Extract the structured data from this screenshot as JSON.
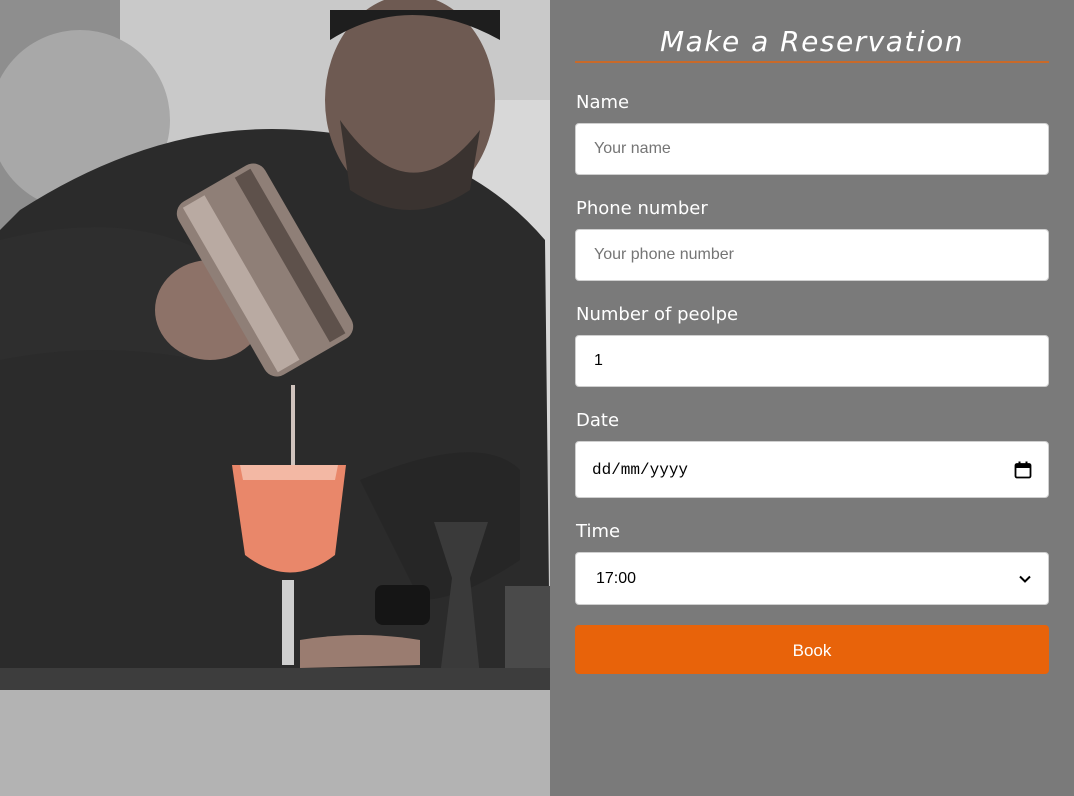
{
  "form": {
    "title": "Make a Reservation",
    "fields": {
      "name": {
        "label": "Name",
        "placeholder": "Your name",
        "value": ""
      },
      "phone": {
        "label": "Phone number",
        "placeholder": "Your phone number",
        "value": ""
      },
      "people": {
        "label": "Number of peolpe",
        "value": "1"
      },
      "date": {
        "label": "Date",
        "value": "dd/mm/yyyy"
      },
      "time": {
        "label": "Time",
        "value": "17:00"
      }
    },
    "submit_label": "Book"
  },
  "colors": {
    "panel_bg": "#7a7a7a",
    "accent": "#e8630a",
    "rule": "#c96a2a"
  },
  "icons": {
    "date": "calendar-icon",
    "time": "chevron-down-icon"
  }
}
